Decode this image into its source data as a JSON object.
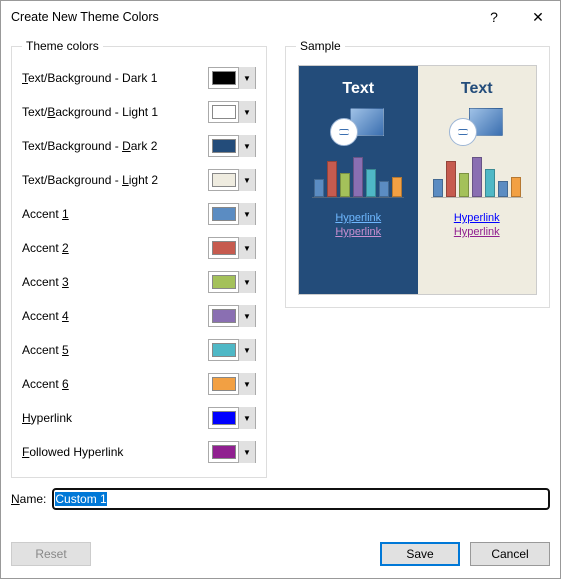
{
  "window": {
    "title": "Create New Theme Colors",
    "help": "?",
    "close": "✕"
  },
  "groups": {
    "theme_colors": "Theme colors",
    "sample": "Sample"
  },
  "theme_colors": [
    {
      "label_pre": "",
      "label_u": "T",
      "label_post": "ext/Background - Dark 1",
      "color": "#000000"
    },
    {
      "label_pre": "Text/",
      "label_u": "B",
      "label_post": "ackground - Light 1",
      "color": "#ffffff"
    },
    {
      "label_pre": "Text/Background - ",
      "label_u": "D",
      "label_post": "ark 2",
      "color": "#234c7a"
    },
    {
      "label_pre": "Text/Background - ",
      "label_u": "L",
      "label_post": "ight 2",
      "color": "#efece0"
    },
    {
      "label_pre": "Accent ",
      "label_u": "1",
      "label_post": "",
      "color": "#5b8cc2"
    },
    {
      "label_pre": "Accent ",
      "label_u": "2",
      "label_post": "",
      "color": "#c65b4f"
    },
    {
      "label_pre": "Accent ",
      "label_u": "3",
      "label_post": "",
      "color": "#a4c15a"
    },
    {
      "label_pre": "Accent ",
      "label_u": "4",
      "label_post": "",
      "color": "#8a6fb2"
    },
    {
      "label_pre": "Accent ",
      "label_u": "5",
      "label_post": "",
      "color": "#4fb8c6"
    },
    {
      "label_pre": "Accent ",
      "label_u": "6",
      "label_post": "",
      "color": "#f2a043"
    },
    {
      "label_pre": "",
      "label_u": "H",
      "label_post": "yperlink",
      "color": "#0000ff"
    },
    {
      "label_pre": "",
      "label_u": "F",
      "label_post": "ollowed Hyperlink",
      "color": "#902090"
    }
  ],
  "sample": {
    "text": "Text",
    "hyperlink": "Hyperlink",
    "followed_hyperlink": "Hyperlink",
    "dark_bg": "#234c7a",
    "light_bg": "#efece0",
    "rect_gradient_from": "#9fc1e6",
    "rect_gradient_to": "#3b6fb0"
  },
  "name": {
    "label_pre": "",
    "label_u": "N",
    "label_post": "ame:",
    "value": "Custom 1"
  },
  "buttons": {
    "reset_pre": "",
    "reset_u": "R",
    "reset_post": "eset",
    "save_pre": "",
    "save_u": "S",
    "save_post": "ave",
    "cancel": "Cancel"
  }
}
